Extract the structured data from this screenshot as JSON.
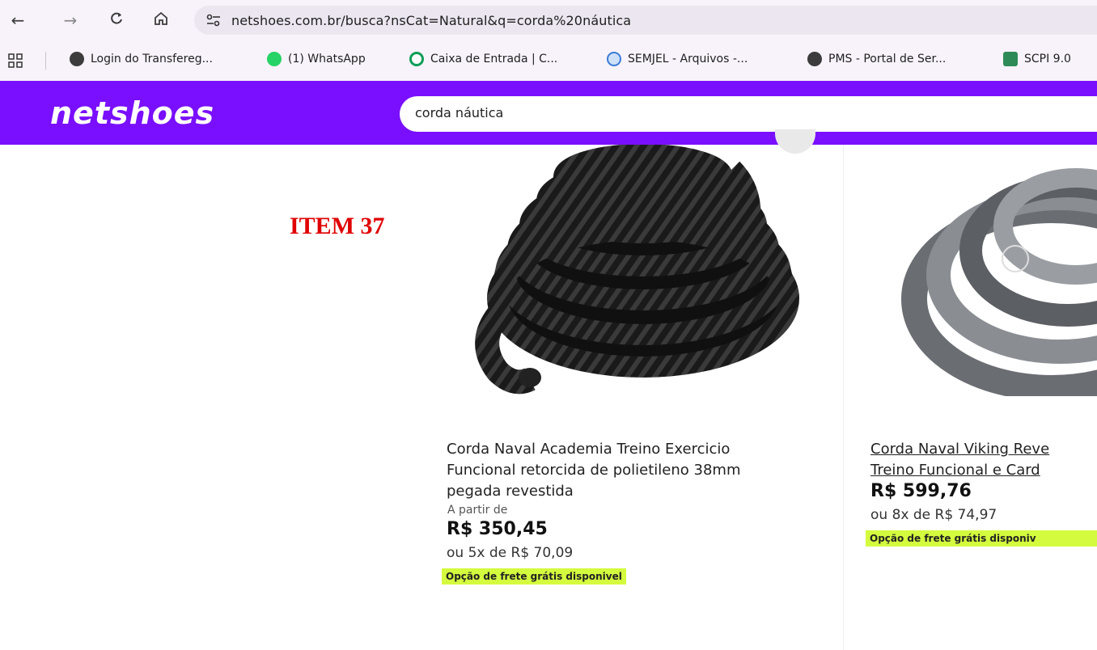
{
  "browser": {
    "url": "netshoes.com.br/busca?nsCat=Natural&q=corda%20náutica",
    "bookmarks": [
      {
        "label": "Login do Transfereg...",
        "icon": "globe-icon"
      },
      {
        "label": "(1) WhatsApp",
        "icon": "whatsapp-icon"
      },
      {
        "label": "Caixa de Entrada | C...",
        "icon": "target-icon"
      },
      {
        "label": "SEMJEL - Arquivos -...",
        "icon": "archive-icon"
      },
      {
        "label": "PMS - Portal de Ser...",
        "icon": "globe-icon"
      },
      {
        "label": "SCPI 9.0",
        "icon": "emblem-icon"
      }
    ]
  },
  "site": {
    "logo": "netshoes",
    "search_value": "corda náutica",
    "accent_color": "#7a0fff"
  },
  "annotation": "ITEM 37",
  "products": [
    {
      "title_lines": [
        "Corda Naval Academia Treino Exercicio",
        "Funcional retorcida de polietileno 38mm",
        "pegada revestida"
      ],
      "from_label": "A partir de",
      "price": "R$ 350,45",
      "installments": "ou 5x de R$ 70,09",
      "shipping": "Opção de frete grátis disponivel"
    },
    {
      "title_lines": [
        "Corda Naval Viking Reve",
        "Treino Funcional e Card"
      ],
      "price": "R$ 599,76",
      "installments": "ou 8x de R$ 74,97",
      "shipping": "Opção de frete grátis disponiv"
    }
  ]
}
